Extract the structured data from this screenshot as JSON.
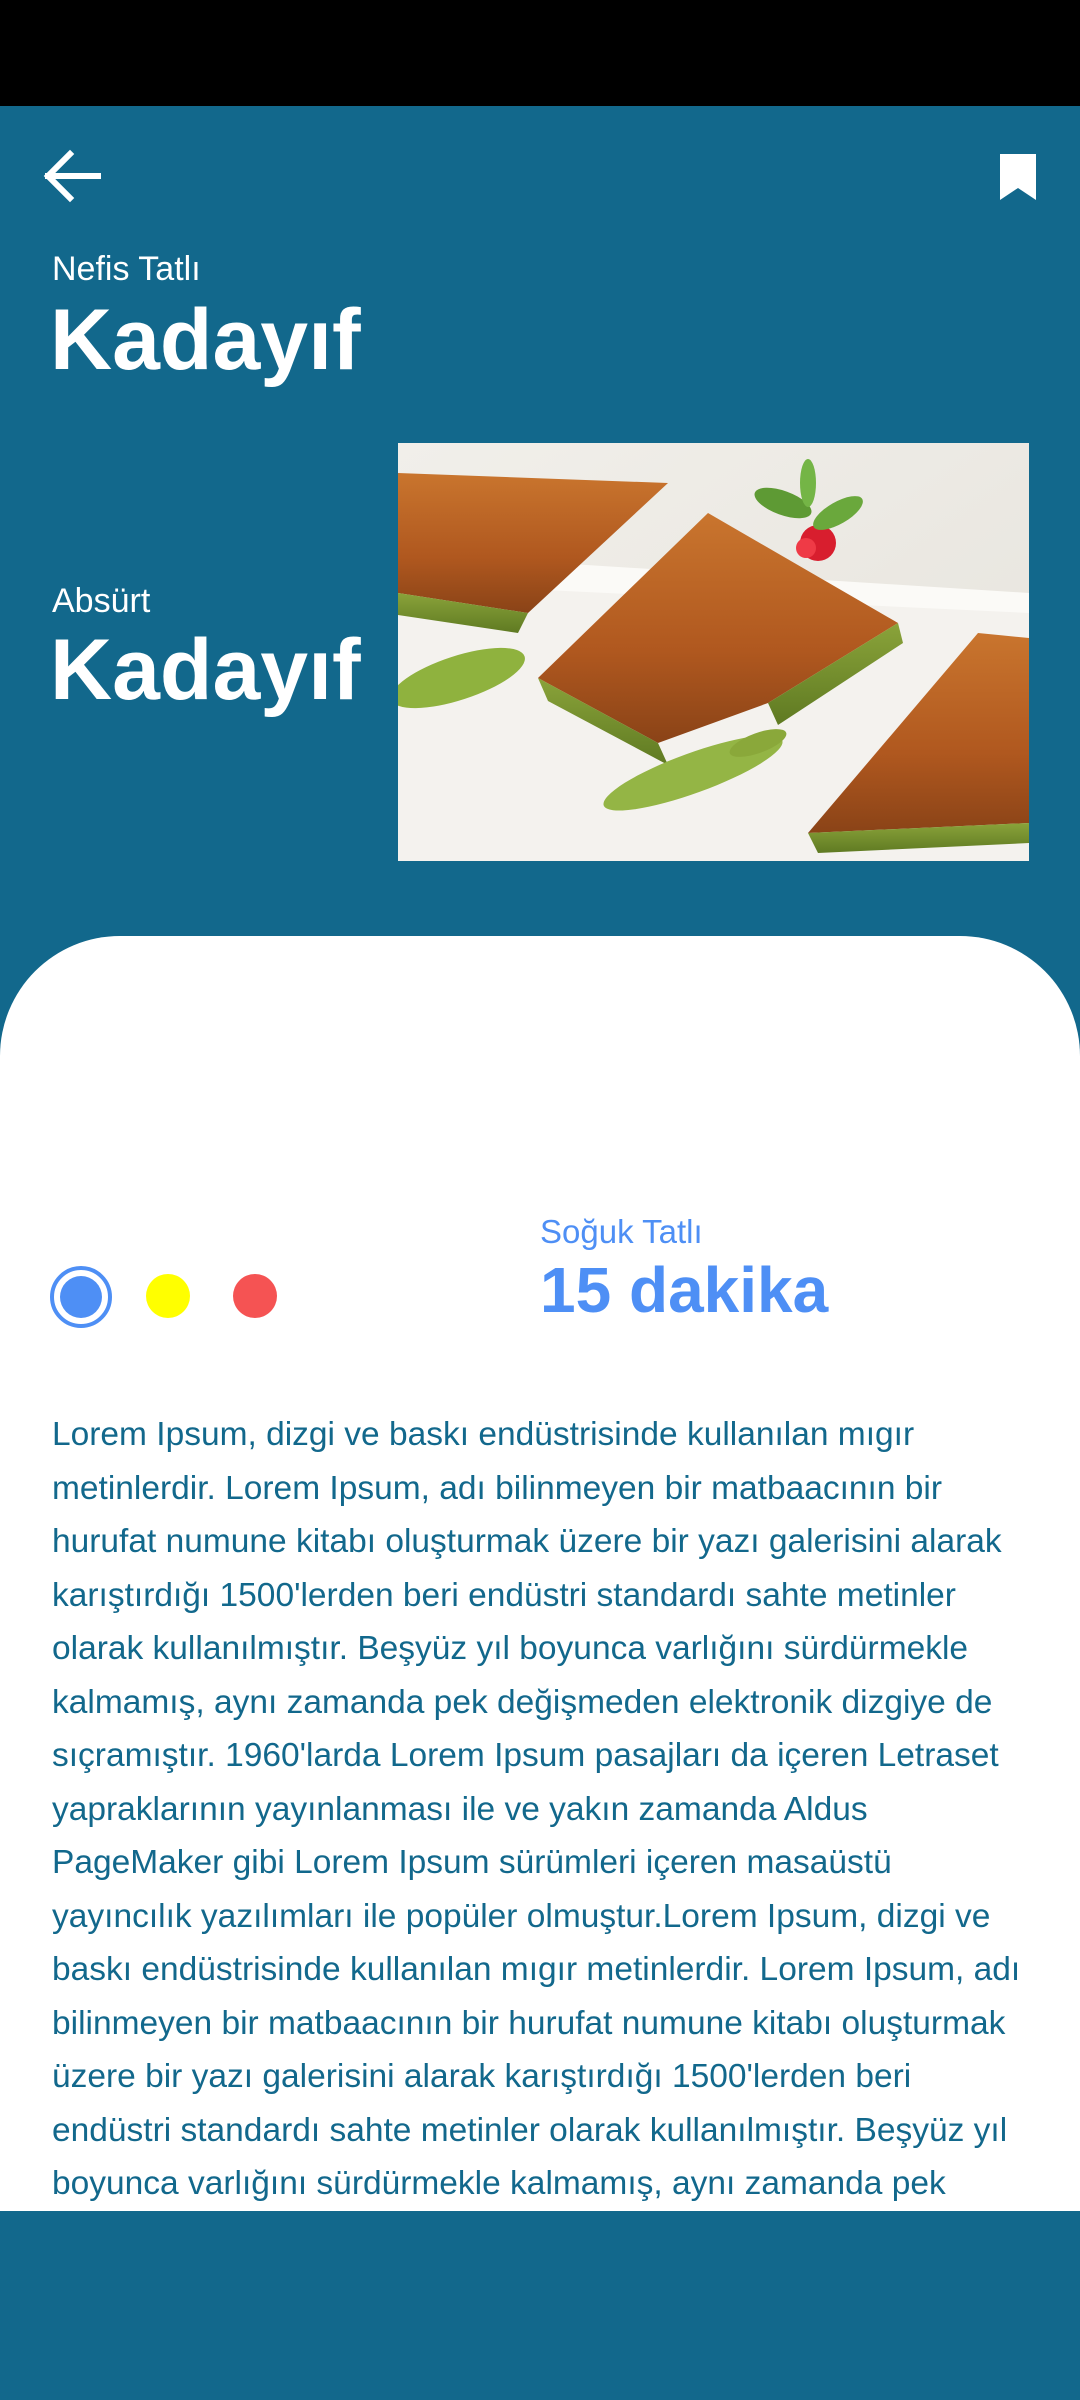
{
  "header": {
    "subtitle_top": "Nefis Tatlı",
    "title_top": "Kadayıf",
    "subtitle_second": "Absürt",
    "title_second": "Kadayıf",
    "colors": {
      "background": "#12688c",
      "text": "#ffffff"
    }
  },
  "icons": {
    "back": "arrow-left-icon",
    "bookmark": "bookmark-icon"
  },
  "details": {
    "category": "Soğuk Tatlı",
    "time": "15 dakika",
    "color_options": [
      {
        "name": "blue",
        "hex": "#4e8ff5",
        "selected": true
      },
      {
        "name": "yellow",
        "hex": "#ffff00",
        "selected": false
      },
      {
        "name": "red",
        "hex": "#f55353",
        "selected": false
      }
    ]
  },
  "description": "Lorem Ipsum, dizgi ve baskı endüstrisinde kullanılan mıgır metinlerdir. Lorem Ipsum, adı bilinmeyen bir matbaacının bir hurufat numune kitabı oluşturmak üzere bir yazı galerisini alarak karıştırdığı 1500'lerden beri endüstri standardı sahte metinler olarak kullanılmıştır. Beşyüz yıl boyunca varlığını sürdürmekle kalmamış, aynı zamanda pek değişmeden elektronik dizgiye de sıçramıştır. 1960'larda Lorem Ipsum pasajları da içeren Letraset yapraklarının yayınlanması ile ve yakın zamanda Aldus PageMaker gibi Lorem Ipsum sürümleri içeren masaüstü yayıncılık yazılımları ile popüler olmuştur.Lorem Ipsum, dizgi ve baskı endüstrisinde kullanılan mıgır metinlerdir. Lorem Ipsum, adı bilinmeyen bir matbaacının bir hurufat numune kitabı oluşturmak üzere bir yazı galerisini alarak karıştırdığı 1500'lerden beri endüstri standardı sahte metinler olarak kullanılmıştır. Beşyüz yıl boyunca varlığını sürdürmekle kalmamış, aynı zamanda pek değişmeden elektronik dizgiye de sıçramıştır."
}
